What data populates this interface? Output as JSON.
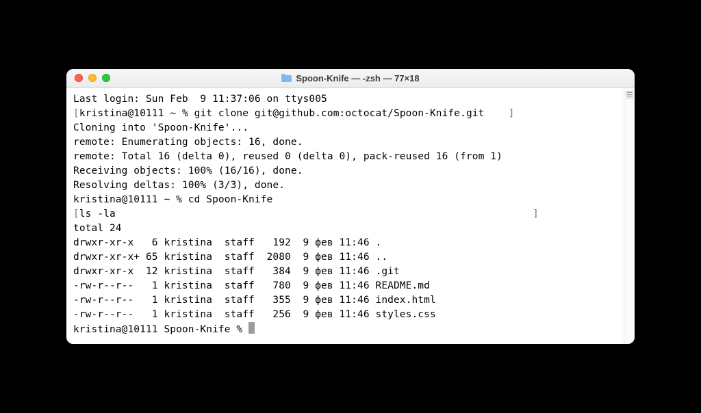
{
  "window": {
    "title": "Spoon-Knife — -zsh — 77×18"
  },
  "terminal": {
    "last_login": "Last login: Sun Feb  9 11:37:06 on ttys005",
    "prompt1_left": "[",
    "prompt1_inner": "kristina@10111 ~ % git clone git@github.com:octocat/Spoon-Knife.git",
    "prompt1_right_pad": "    ]",
    "clone_lines": [
      "Cloning into 'Spoon-Knife'...",
      "remote: Enumerating objects: 16, done.",
      "remote: Total 16 (delta 0), reused 0 (delta 0), pack-reused 16 (from 1)",
      "Receiving objects: 100% (16/16), done.",
      "Resolving deltas: 100% (3/3), done."
    ],
    "cd_line": "kristina@10111 ~ % cd Spoon-Knife",
    "ls_left": "[",
    "ls_inner": "ls -la",
    "ls_right_pad": "                                                                     ]",
    "total": "total 24",
    "rows": [
      "drwxr-xr-x   6 kristina  staff   192  9 фев 11:46 .",
      "drwxr-xr-x+ 65 kristina  staff  2080  9 фев 11:46 ..",
      "drwxr-xr-x  12 kristina  staff   384  9 фев 11:46 .git",
      "-rw-r--r--   1 kristina  staff   780  9 фев 11:46 README.md",
      "-rw-r--r--   1 kristina  staff   355  9 фев 11:46 index.html",
      "-rw-r--r--   1 kristina  staff   256  9 фев 11:46 styles.css"
    ],
    "final_prompt": "kristina@10111 Spoon-Knife % "
  }
}
